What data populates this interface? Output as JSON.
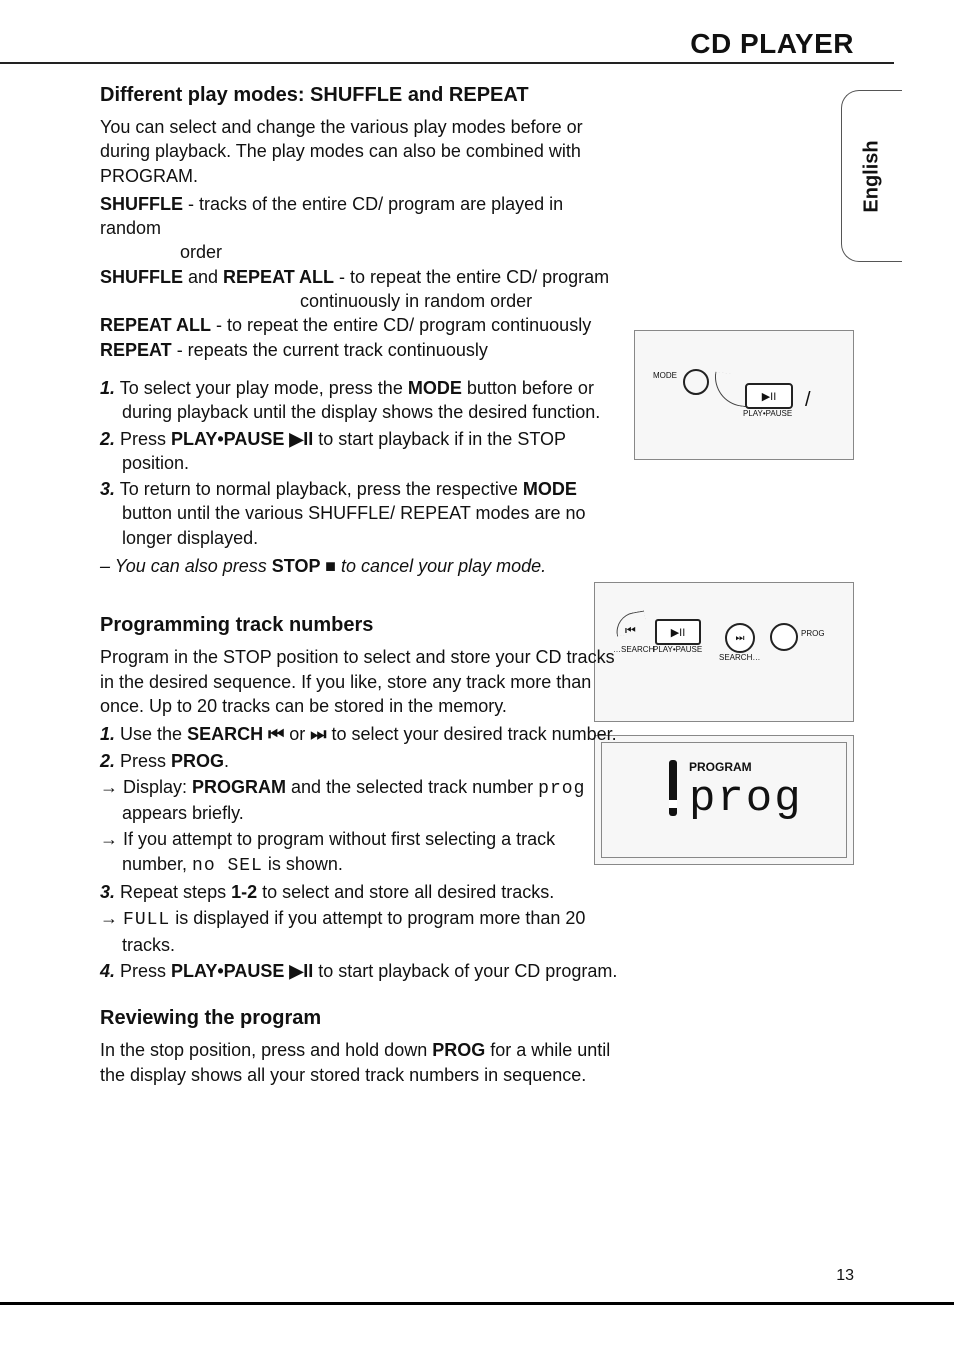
{
  "header": {
    "title": "CD PLAYER"
  },
  "language_tab": "English",
  "page_number": "13",
  "section1": {
    "heading": "Different play modes: SHUFFLE and REPEAT",
    "intro": "You can select and change the various play modes before or during playback. The play modes can also be combined with PROGRAM.",
    "modes": {
      "shuffle_label": "SHUFFLE",
      "shuffle_desc": " - tracks of the entire CD/ program are played in random",
      "shuffle_cont": "order",
      "shuffle_repeat_label_a": "SHUFFLE",
      "shuffle_repeat_and": " and ",
      "shuffle_repeat_label_b": "REPEAT ALL",
      "shuffle_repeat_desc": " - to repeat the entire CD/ program",
      "shuffle_repeat_cont": "continuously in random order",
      "repeat_all_label": "REPEAT ALL",
      "repeat_all_desc": " - to repeat the entire CD/ program continuously",
      "repeat_label": "REPEAT",
      "repeat_desc": " - repeats the current track continuously"
    },
    "steps": {
      "s1_num": "1.",
      "s1_a": " To select your play mode, press the ",
      "s1_b": "MODE",
      "s1_c": " button before or during playback until the display shows the desired function.",
      "s2_num": "2.",
      "s2_a": " Press ",
      "s2_b": "PLAY•PAUSE ▶II",
      "s2_c": " to start playback if in the STOP position.",
      "s3_num": "3.",
      "s3_a": " To return to normal playback, press the respective ",
      "s3_b": "MODE",
      "s3_c": " button until the various SHUFFLE/ REPEAT modes are no longer displayed.",
      "note_dash": "–",
      "note_a": " You can also press ",
      "note_b": "STOP ■",
      "note_c": " to cancel your play mode."
    }
  },
  "section2": {
    "heading": "Programming track numbers",
    "intro": "Program in the STOP position to select and store your CD tracks in the desired sequence. If you like, store any track more than once. Up to 20 tracks can be stored in the memory.",
    "steps": {
      "s1_num": "1.",
      "s1_a": " Use the ",
      "s1_b": "SEARCH ⏮ ",
      "s1_c": "or",
      "s1_d": " ⏭ ",
      "s1_e": "to select your desired track number.",
      "s2_num": "2.",
      "s2_a": " Press ",
      "s2_b": "PROG",
      "s2_c": ".",
      "arrow1_a": "→ Display: ",
      "arrow1_b": "PROGRAM",
      "arrow1_c": " and the selected track number ",
      "arrow1_seg": "prog",
      "arrow1_d": " appears briefly.",
      "arrow2_a": "→ If you attempt to program without first selecting a track number, ",
      "arrow2_seg": "no SEL",
      "arrow2_b": " is shown.",
      "s3_num": "3.",
      "s3_a": " Repeat steps ",
      "s3_b": "1-2",
      "s3_c": " to select and store all desired tracks.",
      "arrow3_a": "→ ",
      "arrow3_seg": "FULL",
      "arrow3_b": " is displayed if you attempt to program more than 20 tracks.",
      "s4_num": "4.",
      "s4_a": " Press ",
      "s4_b": "PLAY•PAUSE ▶II",
      "s4_c": " to start playback of your CD program."
    }
  },
  "section3": {
    "heading": "Reviewing the program",
    "body_a": "In the stop position, press and hold down ",
    "body_b": "PROG",
    "body_c": " for a while until the display shows all your stored track numbers in sequence."
  },
  "figures": {
    "fig1": {
      "mode_label": "MODE",
      "playpause_icon": "▶II",
      "playpause_label": "PLAY•PAUSE"
    },
    "fig2": {
      "search_back_icon": "⏮",
      "search_label": "…SEARCH",
      "playpause_icon": "▶II",
      "playpause_label": "PLAY•PAUSE",
      "fwd_icon": "⏭",
      "fwd_label": "SEARCH…",
      "prog_label": "PROG"
    },
    "fig3": {
      "program_label": "PROGRAM",
      "segment_text": "prog"
    }
  }
}
